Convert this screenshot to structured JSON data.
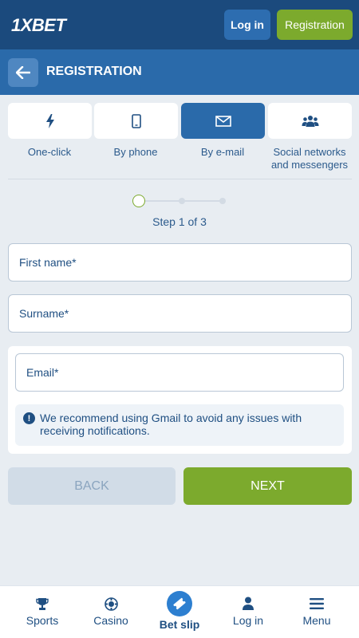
{
  "header": {
    "logo_prefix": "1X",
    "logo_suffix": "BET",
    "login_label": "Log in",
    "registration_label": "Registration"
  },
  "regbar": {
    "title": "REGISTRATION"
  },
  "methods": [
    {
      "label": "One-click",
      "icon": "lightning-icon",
      "active": false
    },
    {
      "label": "By phone",
      "icon": "phone-icon",
      "active": false
    },
    {
      "label": "By e-mail",
      "icon": "envelope-icon",
      "active": true
    },
    {
      "label": "Social networks and messengers",
      "icon": "users-icon",
      "active": false
    }
  ],
  "steps": {
    "text": "Step 1 of 3",
    "current": 1,
    "total": 3
  },
  "form": {
    "first_name_placeholder": "First name*",
    "surname_placeholder": "Surname*",
    "email_placeholder": "Email*",
    "notice_text": "We recommend using Gmail to avoid any issues with receiving notifications."
  },
  "actions": {
    "back_label": "BACK",
    "next_label": "NEXT"
  },
  "bottom_nav": [
    {
      "label": "Sports",
      "icon": "trophy-icon"
    },
    {
      "label": "Casino",
      "icon": "chip-icon"
    },
    {
      "label": "Bet slip",
      "icon": "ticket-icon"
    },
    {
      "label": "Log in",
      "icon": "user-icon"
    },
    {
      "label": "Menu",
      "icon": "menu-icon"
    }
  ],
  "colors": {
    "header_bg": "#1b4a7d",
    "regbar_bg": "#2a6aaa",
    "accent_green": "#7caa2d",
    "text_blue": "#1f4f82"
  }
}
